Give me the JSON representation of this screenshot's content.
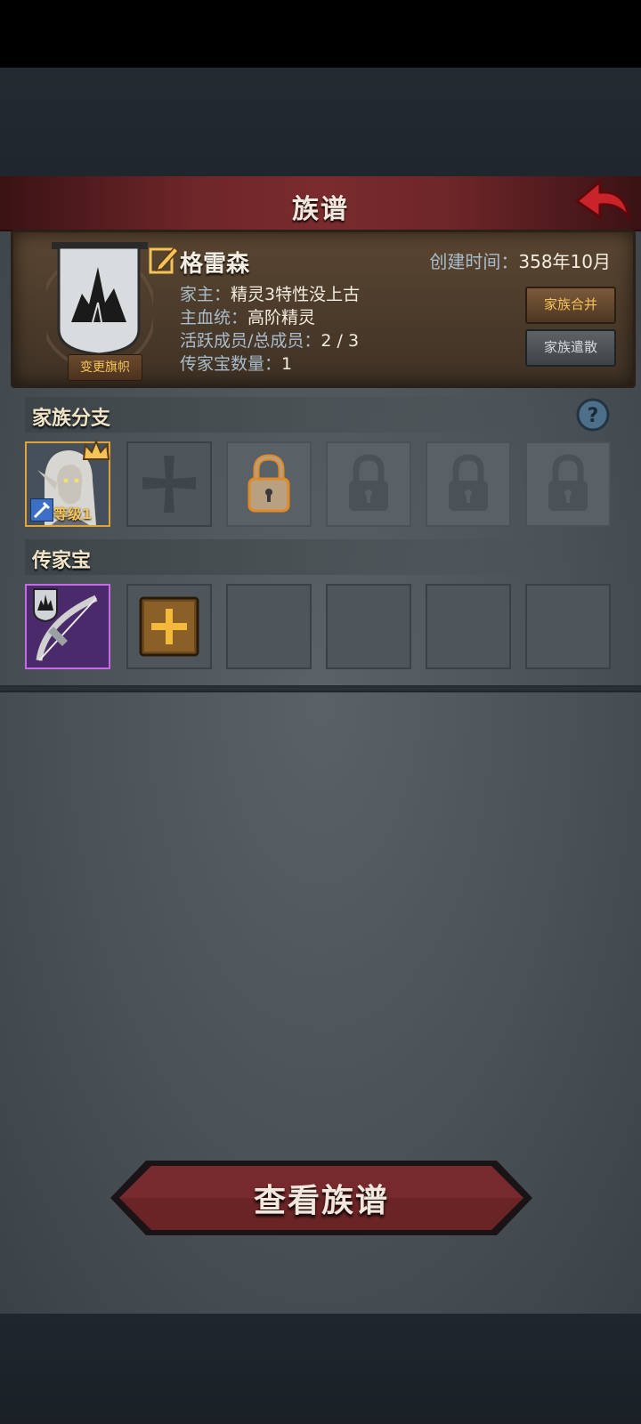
{
  "header": {
    "title": "族谱"
  },
  "family": {
    "change_banner_label": "变更旗帜",
    "name": "格雷森",
    "created_label": "创建时间：",
    "created_value": "358年10月",
    "head_label": "家主：",
    "head_value": "精灵3特性没上古",
    "bloodline_label": "主血统：",
    "bloodline_value": "高阶精灵",
    "members_label": "活跃成员/总成员：",
    "members_value": "2 / 3",
    "heirloom_count_label": "传家宝数量：",
    "heirloom_count_value": "1",
    "merge_button": "家族合并",
    "disband_button": "家族遣散"
  },
  "branches": {
    "title": "家族分支",
    "leader_level": "等级1",
    "slots": [
      "leader",
      "cross",
      "lock-gold",
      "lock",
      "lock",
      "lock"
    ]
  },
  "heirlooms": {
    "title": "传家宝",
    "slots": [
      "bow",
      "add",
      "empty",
      "empty",
      "empty",
      "empty"
    ]
  },
  "footer": {
    "view_button": "查看族谱"
  },
  "colors": {
    "accent_red": "#7a2b2d",
    "gold": "#f4c35a",
    "purple_frame": "#b45ad8"
  }
}
